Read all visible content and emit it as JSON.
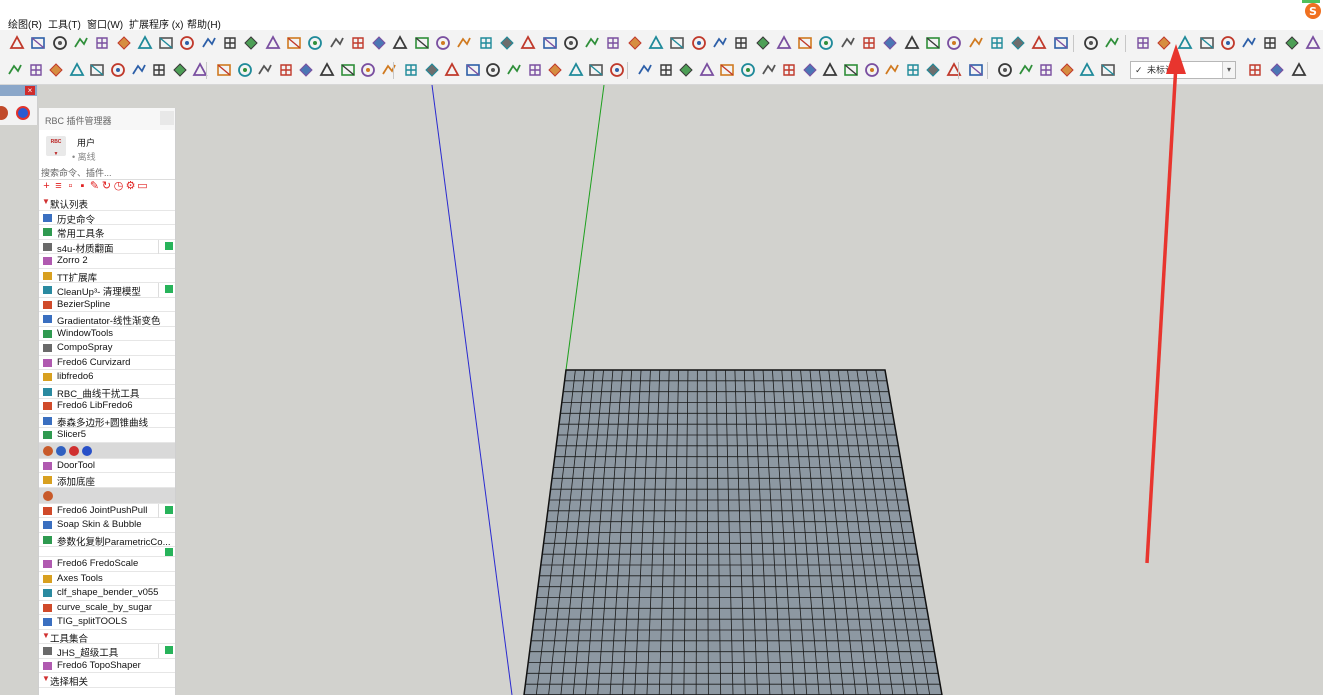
{
  "menubar": {
    "items": [
      {
        "label": "绘图(R)"
      },
      {
        "label": "工具(T)"
      },
      {
        "label": "窗口(W)"
      },
      {
        "label": "扩展程序 (x)"
      },
      {
        "label": "帮助(H)"
      }
    ]
  },
  "toolbar2": {
    "layer_dropdown": {
      "check": "✓",
      "value": "未标记"
    }
  },
  "plugin_manager": {
    "title": "RBC 插件管理器",
    "user": {
      "name": "用户",
      "status": "• 离线"
    },
    "search_placeholder": "搜索命令、插件...",
    "items": [
      {
        "kind": "section",
        "label": "默认列表"
      },
      {
        "kind": "item",
        "label": "历史命令",
        "icon": "history-icon"
      },
      {
        "kind": "item",
        "label": "常用工具条",
        "icon": "star-icon"
      },
      {
        "kind": "item",
        "label": "s4u-材质翻面",
        "icon": "s4u-icon",
        "badge": true
      },
      {
        "kind": "item",
        "label": "Zorro 2",
        "icon": "zorro-icon"
      },
      {
        "kind": "item",
        "label": "TT扩展库",
        "icon": "tt-icon"
      },
      {
        "kind": "item",
        "label": "CleanUp³- 清理模型",
        "icon": "cleanup-icon",
        "badge": true
      },
      {
        "kind": "item",
        "label": "BezierSpline",
        "icon": "bezier-icon"
      },
      {
        "kind": "item",
        "label": "Gradientator-线性渐变色",
        "icon": "gradient-icon"
      },
      {
        "kind": "item",
        "label": "WindowTools",
        "icon": "window-icon"
      },
      {
        "kind": "item",
        "label": "CompoSpray",
        "icon": "spray-icon"
      },
      {
        "kind": "item",
        "label": "Fredo6 Curvizard",
        "icon": "curvizard-icon"
      },
      {
        "kind": "item",
        "label": "libfredo6",
        "icon": "lib-icon"
      },
      {
        "kind": "item",
        "label": "RBC_曲线干扰工具",
        "icon": "curve-icon"
      },
      {
        "kind": "item",
        "label": "Fredo6 LibFredo6",
        "icon": "lib-icon"
      },
      {
        "kind": "item",
        "label": "泰森多边形+圆锥曲线",
        "icon": "voronoi-icon"
      },
      {
        "kind": "item",
        "label": "Slicer5",
        "icon": "slicer-icon"
      },
      {
        "kind": "iconrow"
      },
      {
        "kind": "item",
        "label": "DoorTool",
        "icon": "door-icon"
      },
      {
        "kind": "item",
        "label": "添加底座",
        "icon": "base-icon"
      },
      {
        "kind": "iconrow-single"
      },
      {
        "kind": "item",
        "label": "Fredo6 JointPushPull",
        "icon": "pushpull-icon",
        "badge": true
      },
      {
        "kind": "item",
        "label": "Soap Skin & Bubble",
        "icon": "soap-icon"
      },
      {
        "kind": "item",
        "label": "参数化复制ParametricCo...",
        "icon": "param-icon"
      },
      {
        "kind": "badge-only"
      },
      {
        "kind": "item",
        "label": "Fredo6 FredoScale",
        "icon": "scale-icon"
      },
      {
        "kind": "item",
        "label": "Axes Tools",
        "icon": "axes-icon"
      },
      {
        "kind": "item",
        "label": "clf_shape_bender_v055",
        "icon": "bender-icon"
      },
      {
        "kind": "item",
        "label": "curve_scale_by_sugar",
        "icon": "curvescale-icon"
      },
      {
        "kind": "item",
        "label": "TIG_splitTOOLS",
        "icon": "split-icon"
      },
      {
        "kind": "section",
        "label": "工具集合"
      },
      {
        "kind": "item",
        "label": "JHS_超级工具",
        "icon": "jhs-icon",
        "badge": true
      },
      {
        "kind": "item",
        "label": "Fredo6 TopoShaper",
        "icon": "topo-icon"
      },
      {
        "kind": "section",
        "label": "选择相关"
      }
    ]
  },
  "colors": {
    "blue_axis": "#2a2ad0",
    "green_axis": "#1ea01e",
    "grid_face": "#8d98a2",
    "annotation_arrow": "#e8352e",
    "badge": "#27b35a"
  }
}
